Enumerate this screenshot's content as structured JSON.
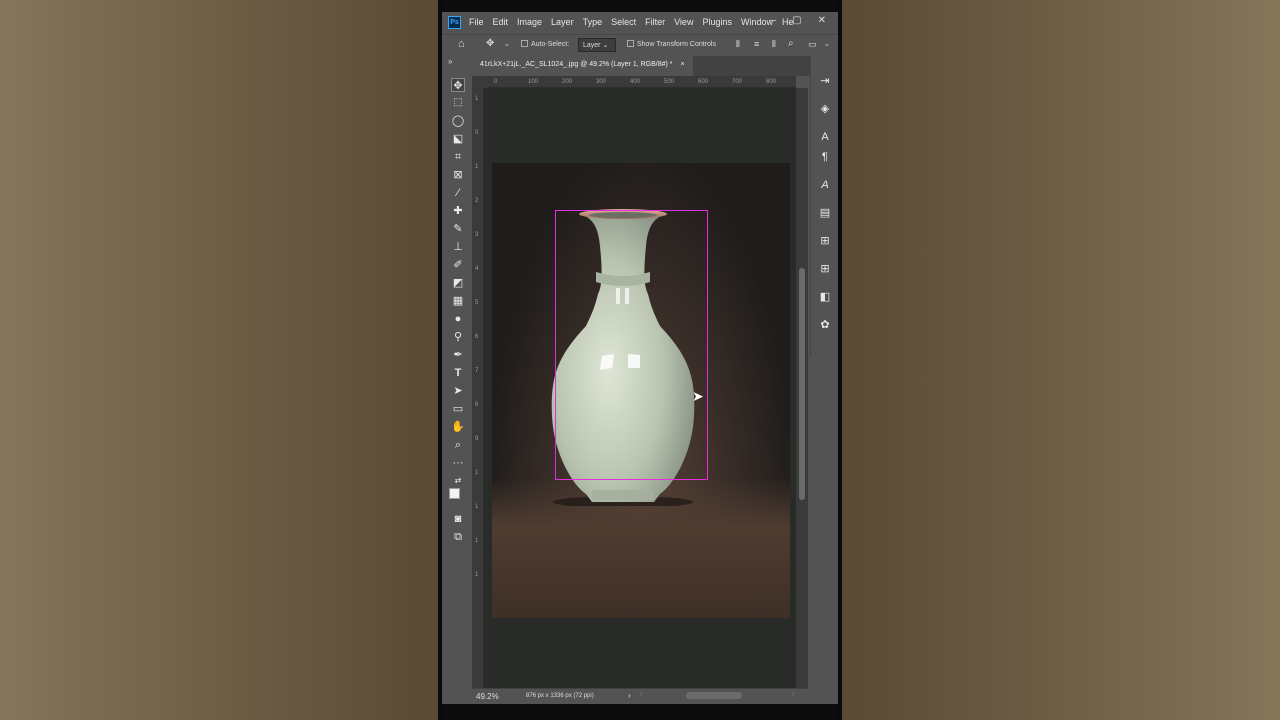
{
  "menubar": {
    "logo": "Ps",
    "items": [
      "File",
      "Edit",
      "Image",
      "Layer",
      "Type",
      "Select",
      "Filter",
      "View",
      "Plugins",
      "Window",
      "He"
    ]
  },
  "options": {
    "auto_select_label": "Auto-Select:",
    "layer_dropdown": "Layer",
    "transform_controls_label": "Show Transform Controls"
  },
  "document": {
    "tab_title": "41rLkX+21jL._AC_SL1024_.jpg @ 49.2% (Layer 1, RGB/8#) *",
    "close_glyph": "×"
  },
  "ruler": {
    "top_ticks": [
      "0",
      "100",
      "200",
      "300",
      "400",
      "500",
      "600",
      "700",
      "800"
    ],
    "left_ticks": [
      "1",
      "0",
      "1",
      "2",
      "3",
      "4",
      "5",
      "6",
      "7",
      "8",
      "9",
      "1",
      "1",
      "1",
      "1"
    ]
  },
  "status": {
    "zoom": "49.2%",
    "doc_info": "876 px x 1336 px (72 ppi)"
  },
  "colors": {
    "selection": "#e22ee0",
    "panel": "#535353",
    "canvas_bg": "#282b28"
  }
}
